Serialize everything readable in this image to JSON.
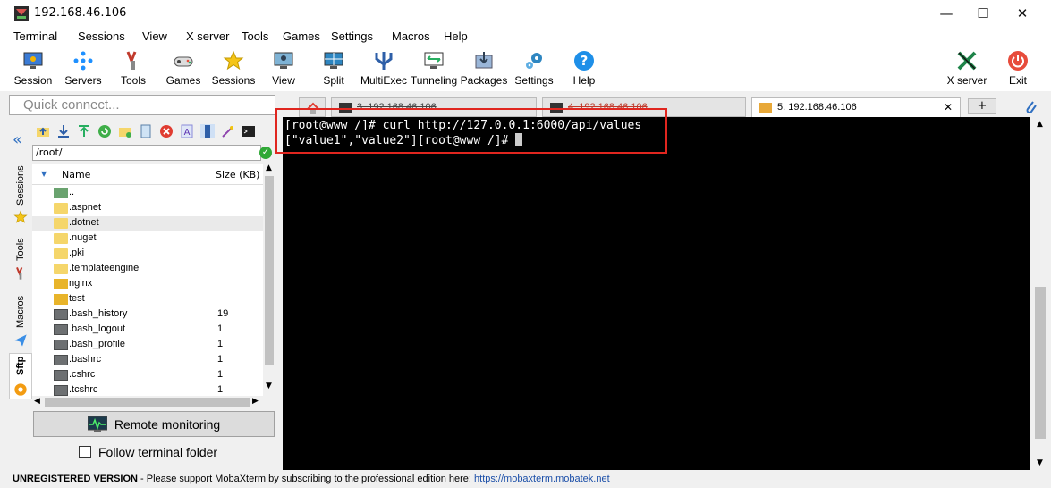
{
  "window": {
    "title": "192.168.46.106",
    "minimize": "—",
    "maximize": "☐",
    "close": "✕"
  },
  "menu": [
    "Terminal",
    "Sessions",
    "View",
    "X server",
    "Tools",
    "Games",
    "Settings",
    "Macros",
    "Help"
  ],
  "toolbar": {
    "left": [
      "Session",
      "Servers",
      "Tools",
      "Games",
      "Sessions",
      "View",
      "Split",
      "MultiExec",
      "Tunneling",
      "Packages",
      "Settings",
      "Help"
    ],
    "right": [
      "X server",
      "Exit"
    ]
  },
  "quick_connect": {
    "placeholder": "Quick connect..."
  },
  "side_tabs": [
    "Sessions",
    "Tools",
    "Macros",
    "Sftp"
  ],
  "sftp": {
    "path": "/root/",
    "columns": {
      "name": "Name",
      "size": "Size (KB)"
    },
    "files": [
      {
        "name": "..",
        "size": "",
        "kind": "up"
      },
      {
        "name": ".aspnet",
        "size": "",
        "kind": "folder"
      },
      {
        "name": ".dotnet",
        "size": "",
        "kind": "folder",
        "selected": true
      },
      {
        "name": ".nuget",
        "size": "",
        "kind": "folder"
      },
      {
        "name": ".pki",
        "size": "",
        "kind": "folder"
      },
      {
        "name": ".templateengine",
        "size": "",
        "kind": "folder"
      },
      {
        "name": "nginx",
        "size": "",
        "kind": "folder-strong"
      },
      {
        "name": "test",
        "size": "",
        "kind": "folder-strong"
      },
      {
        "name": ".bash_history",
        "size": "19",
        "kind": "file"
      },
      {
        "name": ".bash_logout",
        "size": "1",
        "kind": "file"
      },
      {
        "name": ".bash_profile",
        "size": "1",
        "kind": "file"
      },
      {
        "name": ".bashrc",
        "size": "1",
        "kind": "file"
      },
      {
        "name": ".cshrc",
        "size": "1",
        "kind": "file"
      },
      {
        "name": ".tcshrc",
        "size": "1",
        "kind": "file"
      }
    ],
    "remote_monitoring": "Remote monitoring",
    "follow_terminal": "Follow terminal folder"
  },
  "tabs": [
    {
      "label": "3. 192.168.46.106",
      "active": false
    },
    {
      "label": "4. 192.168.46.106",
      "active": false
    },
    {
      "label": "5. 192.168.46.106",
      "active": true
    }
  ],
  "terminal": {
    "line1_prompt": "[root@www /]# curl ",
    "line1_url": "http://127.0.0.1",
    "line1_rest": ":6000/api/values",
    "line2": "[\"value1\",\"value2\"][root@www /]# "
  },
  "status": {
    "bold": "UNREGISTERED VERSION",
    "text": "  -  Please support MobaXterm by subscribing to the professional edition here:  ",
    "link": "https://mobaxterm.mobatek.net"
  },
  "colors": {
    "accent_red": "#e0261f",
    "terminal_bg": "#000000",
    "link": "#1a4ea8"
  }
}
